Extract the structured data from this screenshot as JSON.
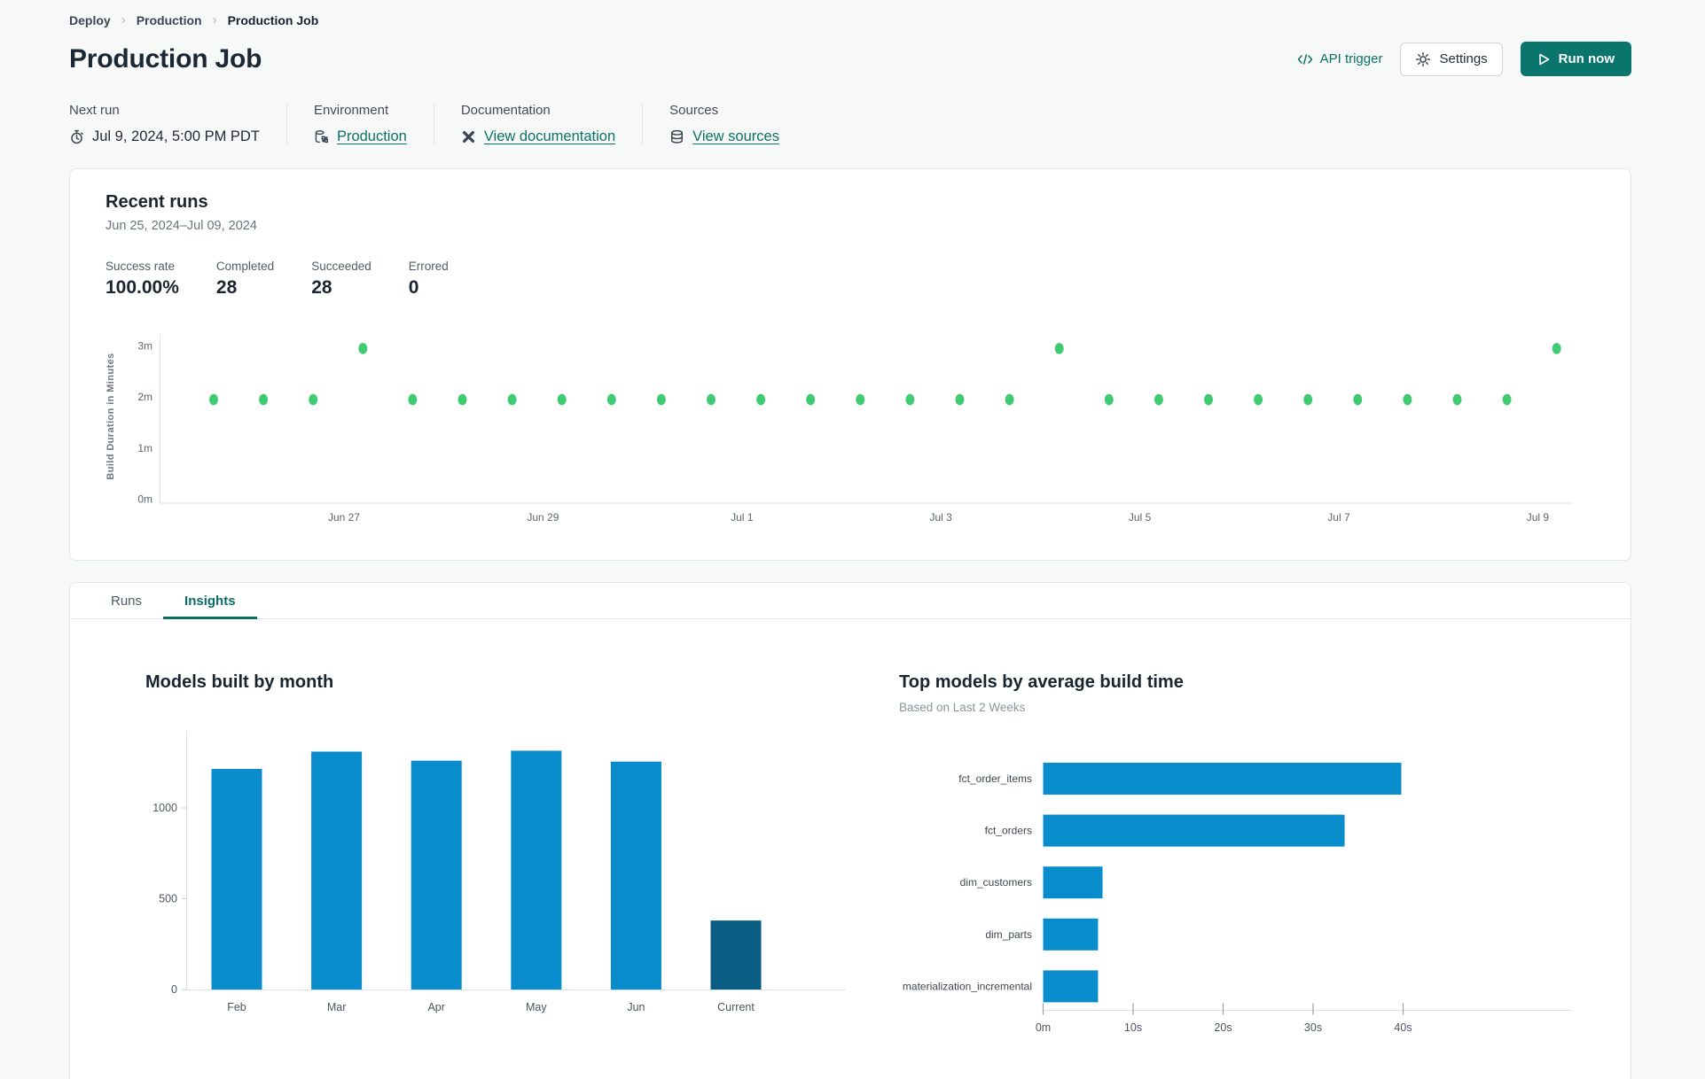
{
  "breadcrumb": {
    "items": [
      "Deploy",
      "Production",
      "Production Job"
    ]
  },
  "header": {
    "title": "Production Job",
    "api_trigger_label": "API trigger",
    "settings_label": "Settings",
    "run_now_label": "Run now"
  },
  "meta": {
    "next_run": {
      "label": "Next run",
      "value": "Jul 9, 2024, 5:00 PM PDT",
      "icon": "stopwatch-icon"
    },
    "environment": {
      "label": "Environment",
      "value": "Production",
      "icon": "environment-icon"
    },
    "documentation": {
      "label": "Documentation",
      "value": "View documentation",
      "icon": "dbt-docs-icon"
    },
    "sources": {
      "label": "Sources",
      "value": "View sources",
      "icon": "database-icon"
    }
  },
  "recent_runs": {
    "title": "Recent runs",
    "date_range": "Jun 25, 2024–Jul 09, 2024",
    "stats": [
      {
        "label": "Success rate",
        "value": "100.00%"
      },
      {
        "label": "Completed",
        "value": "28"
      },
      {
        "label": "Succeeded",
        "value": "28"
      },
      {
        "label": "Errored",
        "value": "0"
      }
    ]
  },
  "tabs": [
    {
      "label": "Runs",
      "active": false
    },
    {
      "label": "Insights",
      "active": true
    }
  ],
  "colors": {
    "accent_teal": "#0a756d",
    "link_teal": "#0c7266",
    "dot_green": "#3ecb71",
    "bar_blue": "#088ccb",
    "bar_dark_blue": "#0b5e83"
  },
  "chart_data": [
    {
      "id": "run-durations",
      "type": "scatter",
      "title": "Recent runs — build duration per run",
      "ylabel": "Build Duration in Minutes",
      "ylim": [
        0,
        3.4
      ],
      "grid": false,
      "point_color": "#3ecb71",
      "yticks": [
        {
          "label": "0m",
          "value": 0
        },
        {
          "label": "1m",
          "value": 1
        },
        {
          "label": "2m",
          "value": 2
        },
        {
          "label": "3m",
          "value": 3
        }
      ],
      "xticks": [
        {
          "label": "Jun 27",
          "pos": 2.62
        },
        {
          "label": "Jun 29",
          "pos": 6.62
        },
        {
          "label": "Jul 1",
          "pos": 10.62
        },
        {
          "label": "Jul 3",
          "pos": 14.62
        },
        {
          "label": "Jul 5",
          "pos": 18.62
        },
        {
          "label": "Jul 7",
          "pos": 22.62
        },
        {
          "label": "Jul 9",
          "pos": 26.62
        }
      ],
      "runs": [
        1.95,
        1.95,
        1.95,
        2.95,
        1.95,
        1.95,
        1.95,
        1.95,
        1.95,
        1.95,
        1.95,
        1.95,
        1.95,
        1.95,
        1.95,
        1.95,
        1.95,
        2.95,
        1.95,
        1.95,
        1.95,
        1.95,
        1.95,
        1.95,
        1.95,
        1.95,
        1.95,
        2.95
      ]
    },
    {
      "id": "models-built-by-month",
      "type": "bar",
      "title": "Models built by month",
      "categories": [
        "Feb",
        "Mar",
        "Apr",
        "May",
        "Jun",
        "Current"
      ],
      "values": [
        1215,
        1310,
        1260,
        1315,
        1255,
        380
      ],
      "ylim": [
        0,
        1400
      ],
      "yticks": [
        {
          "label": "0",
          "value": 0
        },
        {
          "label": "500",
          "value": 500
        },
        {
          "label": "1000",
          "value": 1000
        }
      ],
      "bar_color": "#088ccb",
      "highlight": {
        "index": 5,
        "color": "#0b5e83"
      },
      "grid": false
    },
    {
      "id": "top-models-by-build-time",
      "type": "bar-horizontal",
      "title": "Top models by average build time",
      "subtitle": "Based on Last 2 Weeks",
      "categories": [
        "fct_order_items",
        "fct_orders",
        "dim_customers",
        "dim_parts",
        "materialization_incremental"
      ],
      "values": [
        39.8,
        33.5,
        6.6,
        6.1,
        6.1
      ],
      "xlim": [
        0,
        44
      ],
      "xticks": [
        {
          "label": "0m",
          "value": 0
        },
        {
          "label": "10s",
          "value": 10
        },
        {
          "label": "20s",
          "value": 20
        },
        {
          "label": "30s",
          "value": 30
        },
        {
          "label": "40s",
          "value": 40
        }
      ],
      "bar_color": "#088ccb",
      "grid": false
    }
  ]
}
